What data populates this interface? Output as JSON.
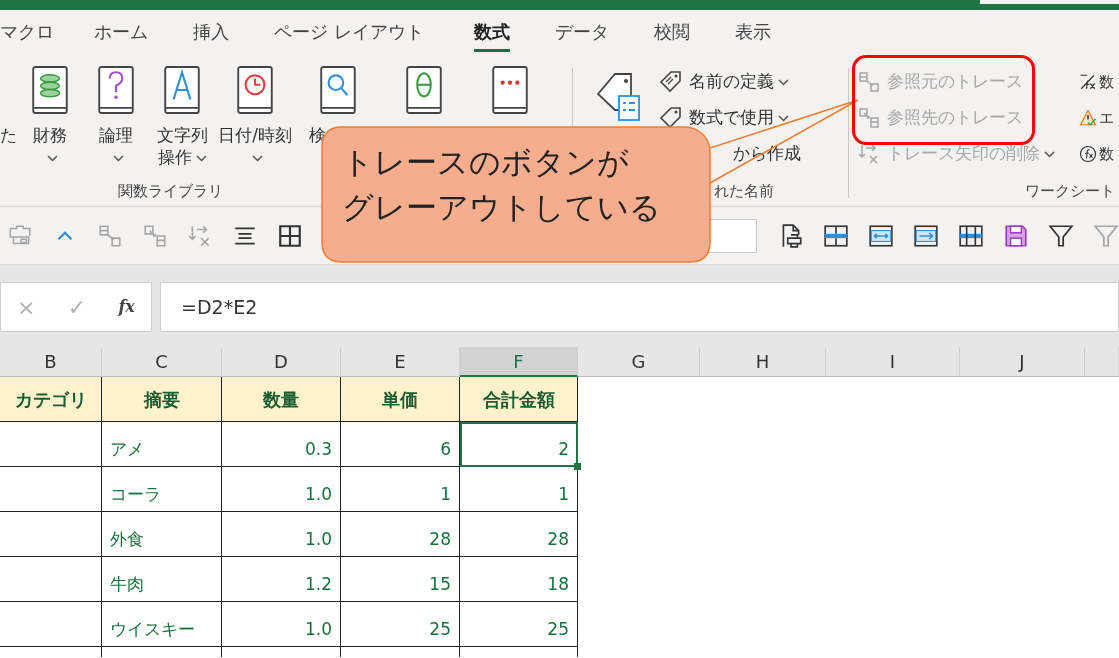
{
  "tabs": [
    {
      "label": "マクロ",
      "selected": false
    },
    {
      "label": "ホーム",
      "selected": false
    },
    {
      "label": "挿入",
      "selected": false
    },
    {
      "label": "ページ レイアウト",
      "selected": false
    },
    {
      "label": "数式",
      "selected": true
    },
    {
      "label": "データ",
      "selected": false
    },
    {
      "label": "校閲",
      "selected": false
    },
    {
      "label": "表示",
      "selected": false
    }
  ],
  "function_library": {
    "buttons": [
      {
        "kind": "label-only",
        "lines": [
          "た"
        ],
        "dropdown": false
      },
      {
        "kind": "financial",
        "lines": [
          "財務"
        ],
        "dropdown": true
      },
      {
        "kind": "logical",
        "lines": [
          "論理"
        ],
        "dropdown": true
      },
      {
        "kind": "text",
        "lines": [
          "文字列",
          "操作"
        ],
        "dropdown": true
      },
      {
        "kind": "datetime",
        "lines": [
          "日付/時刻"
        ],
        "dropdown": true
      },
      {
        "kind": "lookup",
        "lines": [
          "検"
        ]
      },
      {
        "kind": "math"
      },
      {
        "kind": "more"
      }
    ],
    "group_label": "関数ライブラリ"
  },
  "defined_names": {
    "items": [
      {
        "kind": "define",
        "label": "名前の定義",
        "dropdown": true
      },
      {
        "kind": "use",
        "label": "数式で使用",
        "dropdown": true
      },
      {
        "kind": "create",
        "label": "から作成",
        "dropdown": false
      }
    ],
    "group_label": "れた名前"
  },
  "auditing": {
    "items": [
      {
        "kind": "precedents",
        "label": "参照元のトレース",
        "disabled": true,
        "dropdown": false
      },
      {
        "kind": "dependents",
        "label": "参照先のトレース",
        "disabled": true,
        "dropdown": false
      },
      {
        "kind": "remove",
        "label": "トレース矢印の削除",
        "disabled": true,
        "dropdown": true
      }
    ],
    "tools": [
      {
        "kind": "show-formulas",
        "label": "数"
      },
      {
        "kind": "error-check",
        "label": "エ"
      },
      {
        "kind": "evaluate",
        "label": "数"
      }
    ],
    "group_label": "ワークシート"
  },
  "quick_access": {
    "left": [
      {
        "kind": "camera",
        "disabled": true
      },
      {
        "kind": "collapse",
        "disabled": false
      },
      {
        "kind": "precedents",
        "disabled": true
      },
      {
        "kind": "dependents",
        "disabled": true
      },
      {
        "kind": "remove",
        "disabled": true
      },
      {
        "kind": "align",
        "disabled": false
      },
      {
        "kind": "borders",
        "disabled": false
      }
    ],
    "right": [
      {
        "kind": "print-preview",
        "disabled": false
      },
      {
        "kind": "freeze-row",
        "disabled": false
      },
      {
        "kind": "fit-width",
        "disabled": false
      },
      {
        "kind": "move-right",
        "disabled": false
      },
      {
        "kind": "split",
        "disabled": false
      },
      {
        "kind": "save",
        "disabled": false
      },
      {
        "kind": "filter",
        "disabled": false
      },
      {
        "kind": "filter",
        "disabled": true
      }
    ]
  },
  "formula_bar": {
    "cancel": "×",
    "enter": "✓",
    "insert_function": "fx",
    "formula": "=D2*E2"
  },
  "sheet": {
    "columns": [
      {
        "label": "B",
        "selected": false
      },
      {
        "label": "C",
        "selected": false
      },
      {
        "label": "D",
        "selected": false
      },
      {
        "label": "E",
        "selected": false
      },
      {
        "label": "F",
        "selected": true
      },
      {
        "label": "G",
        "selected": false
      },
      {
        "label": "H",
        "selected": false
      },
      {
        "label": "I",
        "selected": false
      },
      {
        "label": "J",
        "selected": false
      }
    ],
    "header": [
      "カテゴリ",
      "摘要",
      "数量",
      "単価",
      "合計金額"
    ],
    "rows": [
      {
        "cells": [
          {
            "text": "アメ",
            "selected": false
          },
          {
            "text": "0.3",
            "selected": false
          },
          {
            "text": "6",
            "selected": false
          },
          {
            "text": "2",
            "selected": true
          }
        ]
      },
      {
        "cells": [
          {
            "text": "コーラ",
            "selected": false
          },
          {
            "text": "1.0",
            "selected": false
          },
          {
            "text": "1",
            "selected": false
          },
          {
            "text": "1",
            "selected": false
          }
        ]
      },
      {
        "cells": [
          {
            "text": "外食",
            "selected": false
          },
          {
            "text": "1.0",
            "selected": false
          },
          {
            "text": "28",
            "selected": false
          },
          {
            "text": "28",
            "selected": false
          }
        ]
      },
      {
        "cells": [
          {
            "text": "牛肉",
            "selected": false
          },
          {
            "text": "1.2",
            "selected": false
          },
          {
            "text": "15",
            "selected": false
          },
          {
            "text": "18",
            "selected": false
          }
        ]
      },
      {
        "cells": [
          {
            "text": "ウイスキー",
            "selected": false
          },
          {
            "text": "1.0",
            "selected": false
          },
          {
            "text": "25",
            "selected": false
          },
          {
            "text": "25",
            "selected": false
          }
        ]
      }
    ]
  },
  "annotation": {
    "highlight": true,
    "callout_lines": [
      "トレースのボタンが",
      "グレーアウトしている"
    ]
  }
}
